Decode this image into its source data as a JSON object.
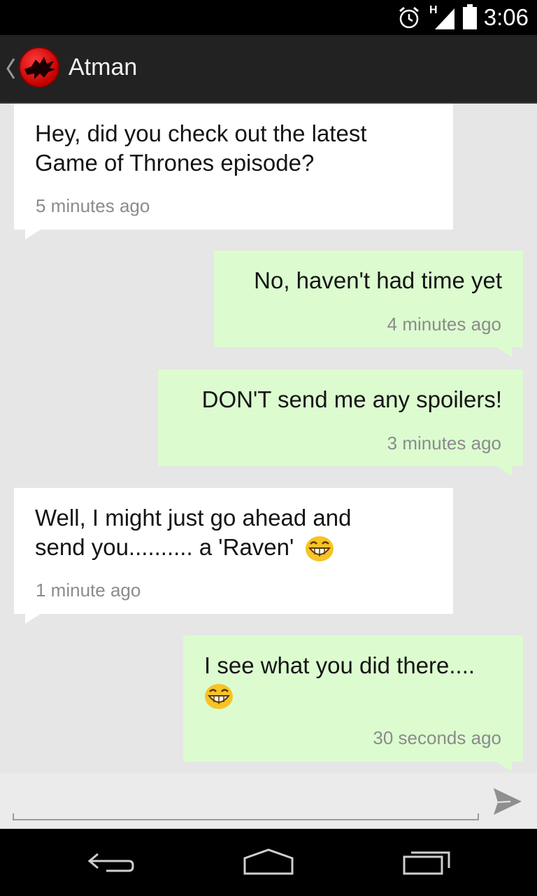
{
  "status_bar": {
    "time": "3:06",
    "network_type": "H",
    "icons": [
      "alarm-icon",
      "signal-icon",
      "battery-icon"
    ]
  },
  "action_bar": {
    "contact_name": "Atman",
    "avatar_icon": "raven-avatar-icon",
    "back_icon": "back-chevron-icon"
  },
  "messages": [
    {
      "direction": "incoming",
      "text_lines": [
        "Hey, did you check out the latest",
        "Game of Thrones episode?"
      ],
      "time": "5 minutes ago"
    },
    {
      "direction": "outgoing",
      "text_lines": [
        "No, haven't had time yet"
      ],
      "time": "4 minutes ago"
    },
    {
      "direction": "outgoing",
      "text_lines": [
        "DON'T send me any spoilers!"
      ],
      "time": "3 minutes ago"
    },
    {
      "direction": "incoming",
      "text_lines": [
        "Well, I might just go ahead and",
        "send you.......... a 'Raven'"
      ],
      "emoji": "grinning-face",
      "time": "1 minute ago"
    },
    {
      "direction": "outgoing",
      "text_lines": [
        "I see what you did there...."
      ],
      "emoji": "grinning-face",
      "time": "30 seconds ago"
    }
  ],
  "composer": {
    "placeholder": "",
    "value": "",
    "send_icon": "send-icon"
  },
  "nav_bar": {
    "icons": [
      "back-icon",
      "home-icon",
      "recent-apps-icon"
    ]
  },
  "colors": {
    "incoming_bubble": "#ffffff",
    "outgoing_bubble": "#dcfcd0",
    "background": "#e6e6e6",
    "action_bar": "#222222",
    "avatar": "#d00000"
  }
}
